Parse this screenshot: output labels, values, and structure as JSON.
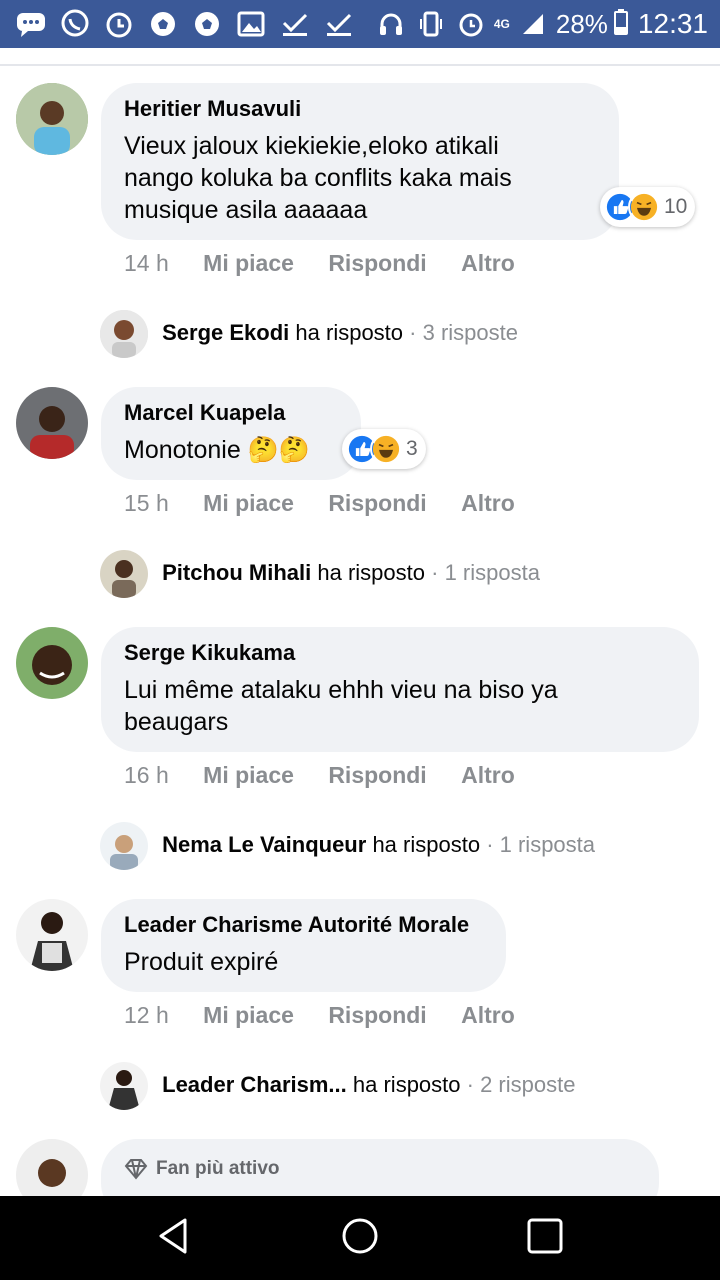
{
  "status_bar": {
    "battery": "28%",
    "time": "12:31",
    "network": "4G",
    "left_icons": [
      "message-icon",
      "whatsapp-icon",
      "alarm-icon",
      "soccer-ball-icon",
      "soccer-ball-icon",
      "gallery-icon",
      "check-icon",
      "check-icon"
    ],
    "right_icons": [
      "headset-icon",
      "vibrate-icon",
      "alarm-icon",
      "signal-icon",
      "battery-icon"
    ]
  },
  "comments": [
    {
      "author": "Heritier Musavuli",
      "text_lines": [
        "Vieux jaloux kiekiekie,eloko atikali",
        "nango koluka ba conflits kaka mais",
        "musique asila aaaaaa"
      ],
      "time": "14 h",
      "reactions": "10",
      "reply": {
        "name": "Serge Ekodi",
        "verb": "ha risposto",
        "count": "· 3 risposte"
      }
    },
    {
      "author": "Marcel Kuapela",
      "text_lines": [
        "Monotonie 🤔🤔"
      ],
      "time": "15 h",
      "reactions": "3",
      "reply": {
        "name": "Pitchou Mihali",
        "verb": "ha risposto",
        "count": "· 1 risposta"
      }
    },
    {
      "author": "Serge Kikukama",
      "text_lines": [
        "Lui même atalaku ehhh vieu na biso ya",
        "beaugars"
      ],
      "time": "16 h",
      "reply": {
        "name": "Nema Le Vainqueur",
        "verb": "ha risposto",
        "count": "· 1 risposta"
      }
    },
    {
      "author": "Leader Charisme Autorité Morale",
      "text_lines": [
        "Produit expiré"
      ],
      "time": "12 h",
      "reply": {
        "name": "Leader Charism...",
        "verb": "ha risposto",
        "count": "· 2 risposte"
      }
    }
  ],
  "actions": {
    "like": "Mi piace",
    "reply": "Rispondi",
    "more": "Altro"
  },
  "last_comment": {
    "badge": "Fan più attivo"
  },
  "colors": {
    "status_bar": "#3b5998",
    "bubble": "#f0f2f5",
    "muted": "#8a8d91",
    "like_blue": "#1877f2",
    "haha_yellow": "#f7b125"
  }
}
